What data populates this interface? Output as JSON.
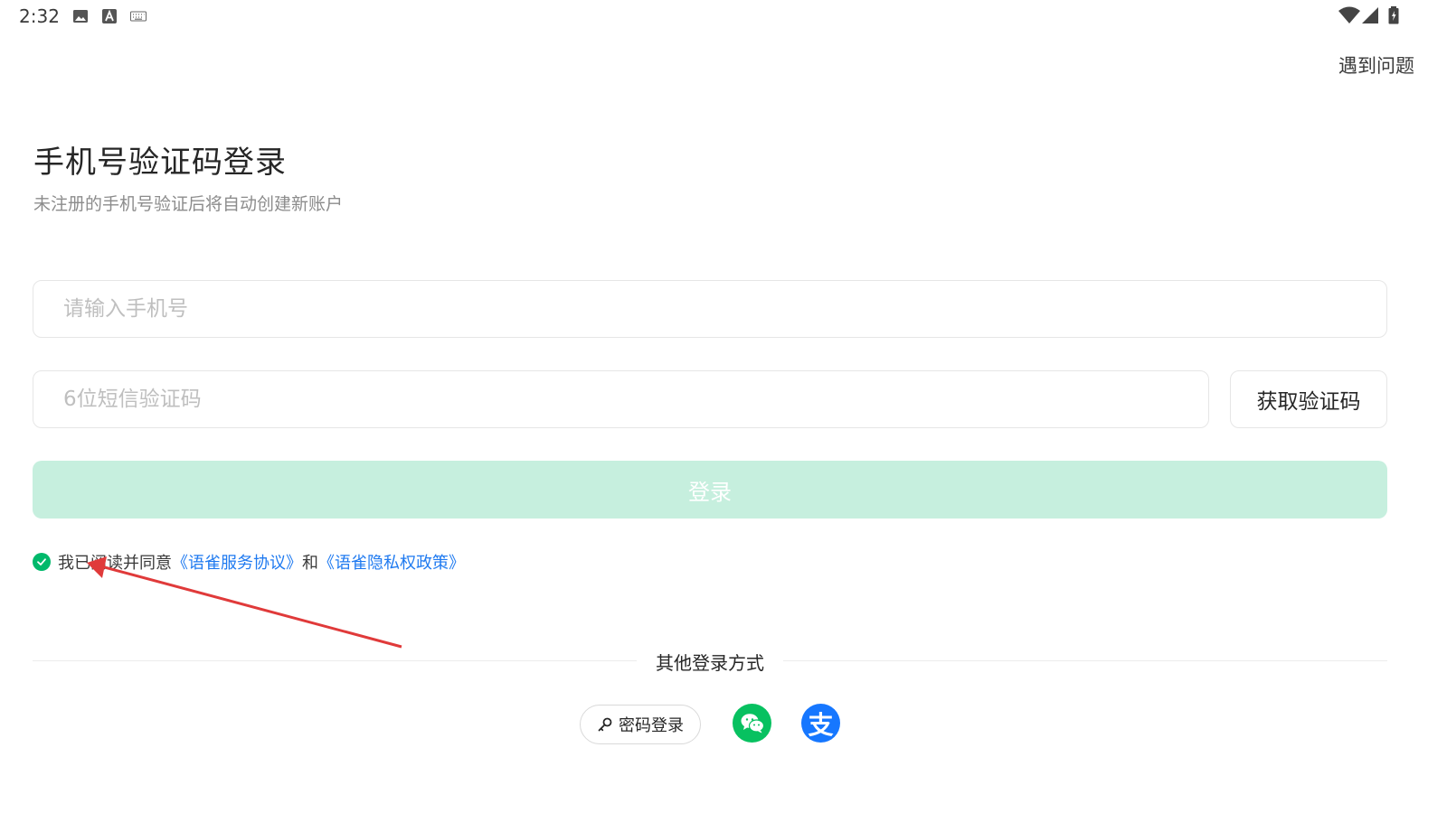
{
  "status_bar": {
    "time": "2:32",
    "icons": [
      "image-icon",
      "a-icon",
      "keyboard-icon",
      "wifi-icon",
      "signal-icon",
      "battery-icon"
    ]
  },
  "header": {
    "help_label": "遇到问题"
  },
  "main": {
    "title": "手机号验证码登录",
    "subtitle": "未注册的手机号验证后将自动创建新账户",
    "phone_placeholder": "请输入手机号",
    "code_placeholder": "6位短信验证码",
    "get_code_label": "获取验证码",
    "login_label": "登录"
  },
  "agreement": {
    "checked": true,
    "prefix": "我已阅读并同意",
    "service_link": "《语雀服务协议》",
    "conjunction": "和",
    "privacy_link": "《语雀隐私权政策》"
  },
  "other_login": {
    "divider_text": "其他登录方式",
    "password_label": "密码登录",
    "methods": [
      "wechat-icon",
      "alipay-icon"
    ],
    "alipay_glyph": "支"
  },
  "colors": {
    "accent": "#00b96b",
    "login_disabled_bg": "#c6efde",
    "link": "#1f7af0",
    "annotation": "#e03a3a",
    "wechat": "#07c160",
    "alipay": "#1677ff"
  }
}
